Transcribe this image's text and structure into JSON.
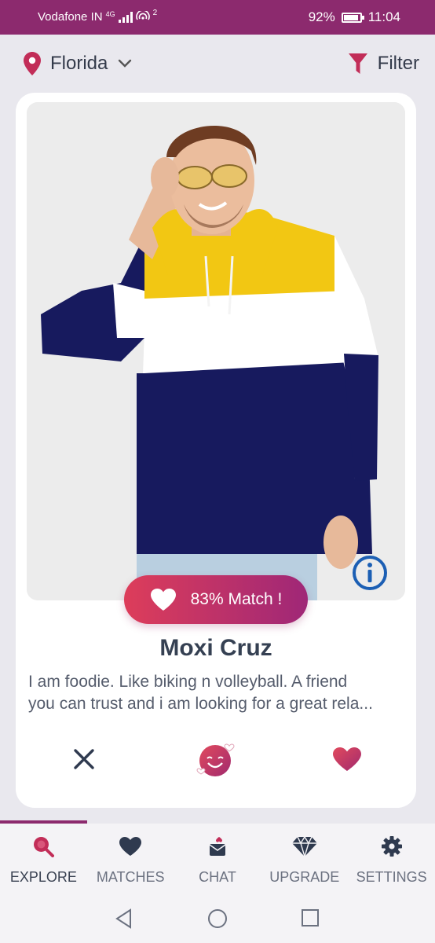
{
  "status": {
    "carrier": "Vodafone IN",
    "net": "4G",
    "hotspot_badge": "2",
    "battery": "92%",
    "battery_level": 0.92,
    "time": "11:04"
  },
  "topbar": {
    "location": "Florida",
    "filter_label": "Filter"
  },
  "profile": {
    "match_label": "83% Match !",
    "name": "Moxi  Cruz",
    "bio_line1": "I am foodie. Like biking n volleyball. A friend",
    "bio_line2": "you can trust and i am looking for a great rela..."
  },
  "nav": {
    "active_progress": 0.2,
    "items": [
      {
        "label": "EXPLORE",
        "icon": "search-icon"
      },
      {
        "label": "MATCHES",
        "icon": "heart-icon"
      },
      {
        "label": "CHAT",
        "icon": "chat-icon"
      },
      {
        "label": "UPGRADE",
        "icon": "diamond-icon"
      },
      {
        "label": "SETTINGS",
        "icon": "gear-icon"
      }
    ]
  },
  "colors": {
    "brand": "#8c2a6e",
    "accent_start": "#dd3d5a",
    "accent_end": "#9f2777",
    "info_blue": "#1c5fb4"
  }
}
